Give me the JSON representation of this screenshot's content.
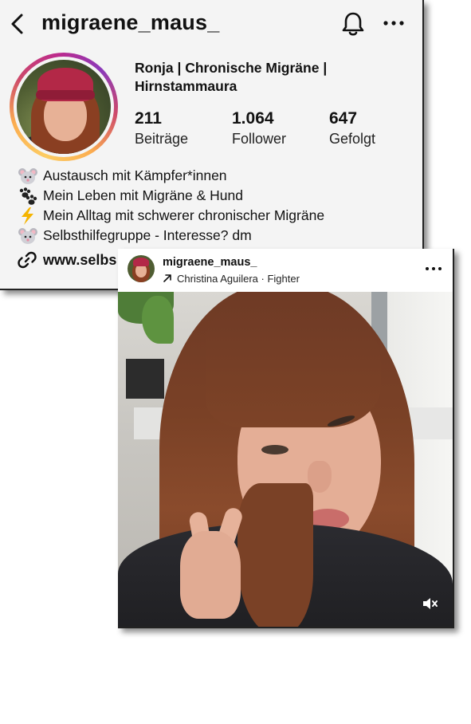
{
  "profile": {
    "username": "migraene_maus_",
    "display_name_line1": "Ronja | Chronische Migräne |",
    "display_name_line2": "Hirnstammaura",
    "stats": [
      {
        "value": "211",
        "label": "Beiträge"
      },
      {
        "value": "1.064",
        "label": "Follower"
      },
      {
        "value": "647",
        "label": "Gefolgt"
      }
    ],
    "bio": [
      {
        "icon": "mouse-face-emoji",
        "text": "Austausch mit Kämpfer*innen"
      },
      {
        "icon": "paw-prints-emoji",
        "text": "Mein Leben mit Migräne & Hund"
      },
      {
        "icon": "lightning-emoji",
        "text": "Mein Alltag mit schwerer chronischer Migräne"
      },
      {
        "icon": "mouse-face-emoji",
        "text": "Selbsthilfegruppe - Interesse? dm"
      }
    ],
    "link_text": "www.selbs"
  },
  "post": {
    "username": "migraene_maus_",
    "audio": "Christina Aguilera · Fighter"
  },
  "colors": {
    "card_background": "#f4f4f4",
    "story_ring": [
      "#fccc63",
      "#fbad50",
      "#cd486b",
      "#bc2a8d",
      "#8a3ab9"
    ],
    "lightning": "#f4b400"
  },
  "icons": [
    "back-arrow-icon",
    "bell-icon",
    "more-icon",
    "link-icon",
    "arrow-up-right-icon",
    "muted-speaker-icon"
  ]
}
